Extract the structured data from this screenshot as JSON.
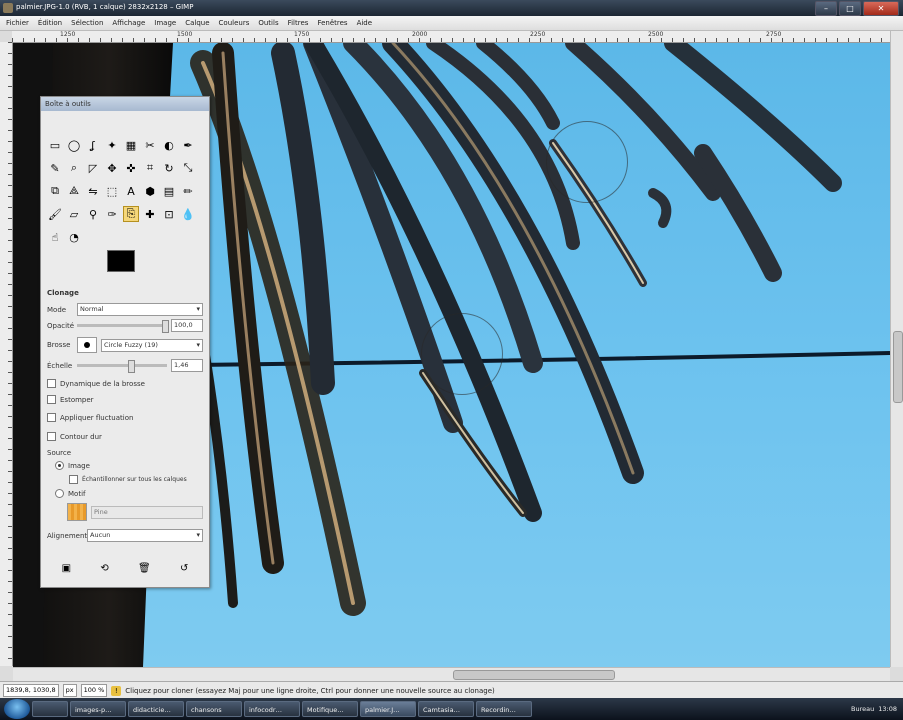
{
  "window": {
    "title": "palmier.JPG-1.0 (RVB, 1 calque) 2832x2128 – GIMP",
    "controls": {
      "minimize": "–",
      "maximize": "□",
      "close": "✕"
    }
  },
  "menu": [
    "Fichier",
    "Édition",
    "Sélection",
    "Affichage",
    "Image",
    "Calque",
    "Couleurs",
    "Outils",
    "Filtres",
    "Fenêtres",
    "Aide"
  ],
  "ruler_top": [
    "1250",
    "1500",
    "1750",
    "2000",
    "2250",
    "2500",
    "2750"
  ],
  "toolbox": {
    "title": "Boîte à outils",
    "tools": [
      {
        "name": "rect-select-icon",
        "glyph": "▭"
      },
      {
        "name": "ellipse-select-icon",
        "glyph": "◯"
      },
      {
        "name": "lasso-icon",
        "glyph": "ʆ"
      },
      {
        "name": "fuzzy-select-icon",
        "glyph": "✦"
      },
      {
        "name": "color-select-icon",
        "glyph": "▦"
      },
      {
        "name": "scissors-icon",
        "glyph": "✂"
      },
      {
        "name": "foreground-select-icon",
        "glyph": "◐"
      },
      {
        "name": "paths-icon",
        "glyph": "✒"
      },
      {
        "name": "color-picker-icon",
        "glyph": "✎"
      },
      {
        "name": "zoom-icon",
        "glyph": "⌕"
      },
      {
        "name": "measure-icon",
        "glyph": "◸"
      },
      {
        "name": "move-icon",
        "glyph": "✥"
      },
      {
        "name": "align-icon",
        "glyph": "✜"
      },
      {
        "name": "crop-icon",
        "glyph": "⌗"
      },
      {
        "name": "rotate-icon",
        "glyph": "↻"
      },
      {
        "name": "scale-icon",
        "glyph": "⤡"
      },
      {
        "name": "shear-icon",
        "glyph": "⧉"
      },
      {
        "name": "perspective-icon",
        "glyph": "⟁"
      },
      {
        "name": "flip-icon",
        "glyph": "⇋"
      },
      {
        "name": "cage-icon",
        "glyph": "⬚"
      },
      {
        "name": "text-icon",
        "glyph": "A"
      },
      {
        "name": "bucket-fill-icon",
        "glyph": "⬢"
      },
      {
        "name": "blend-icon",
        "glyph": "▤"
      },
      {
        "name": "pencil-icon",
        "glyph": "✏"
      },
      {
        "name": "paintbrush-icon",
        "glyph": "🖌"
      },
      {
        "name": "eraser-icon",
        "glyph": "▱"
      },
      {
        "name": "airbrush-icon",
        "glyph": "⚲"
      },
      {
        "name": "ink-icon",
        "glyph": "✑"
      },
      {
        "name": "clone-icon",
        "glyph": "⎘"
      },
      {
        "name": "heal-icon",
        "glyph": "✚"
      },
      {
        "name": "perspective-clone-icon",
        "glyph": "⊡"
      },
      {
        "name": "blur-icon",
        "glyph": "💧"
      },
      {
        "name": "smudge-icon",
        "glyph": "☝"
      },
      {
        "name": "dodge-burn-icon",
        "glyph": "◔"
      }
    ],
    "active_tool_index": 28,
    "colors": {
      "fg": "#000000",
      "bg": "#ffffff"
    },
    "options_title": "Clonage",
    "mode_label": "Mode",
    "mode_value": "Normal",
    "opacity_label": "Opacité",
    "opacity_value": "100,0",
    "opacity_level": 1.0,
    "brush_label": "Brosse",
    "brush_value": "Circle Fuzzy (19)",
    "scale_label": "Échelle",
    "scale_value": "1,46",
    "scale_level": 0.6,
    "checkboxes": [
      {
        "label": "Dynamique de la brosse",
        "checked": false
      },
      {
        "label": "Estomper",
        "checked": false
      },
      {
        "label": "Appliquer fluctuation",
        "checked": false
      },
      {
        "label": "Contour dur",
        "checked": false
      }
    ],
    "source_label": "Source",
    "source_image": "Image",
    "sample_merged": "Échantillonner sur tous les calques",
    "source_pattern": "Motif",
    "pattern_name": "Pine",
    "alignment_label": "Alignement",
    "alignment_value": "Aucun"
  },
  "status": {
    "coords": "1839,8, 1030,8",
    "unit": "px",
    "zoom": "100 %",
    "message": "Cliquez pour cloner (essayez Maj pour une ligne droite, Ctrl pour donner une nouvelle source au clonage)"
  },
  "taskbar": {
    "items": [
      "",
      "images-p…",
      "didacticie…",
      "chansons",
      "infocodr…",
      "Motifique…",
      "palmier.J…",
      "Camtasia…",
      "Recordin…"
    ],
    "active_index": 6,
    "tray_label": "Bureau",
    "clock": "13:08"
  }
}
